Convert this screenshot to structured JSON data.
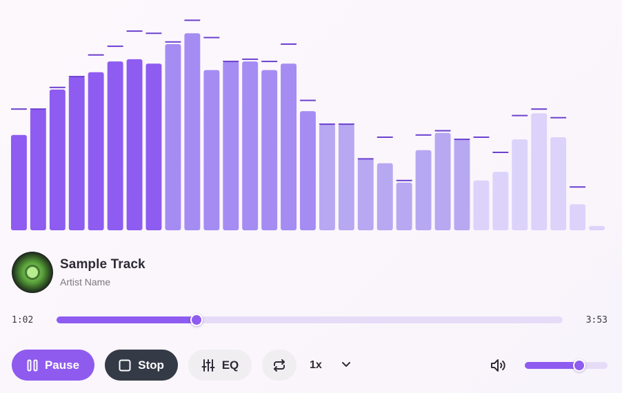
{
  "visualizer": {
    "levels": [
      0.44,
      0.56,
      0.65,
      0.71,
      0.73,
      0.78,
      0.79,
      0.77,
      0.86,
      0.91,
      0.74,
      0.78,
      0.78,
      0.74,
      0.77,
      0.55,
      0.49,
      0.49,
      0.33,
      0.31,
      0.22,
      0.37,
      0.45,
      0.42,
      0.23,
      0.27,
      0.42,
      0.54,
      0.43,
      0.12,
      0.02
    ],
    "peaks": [
      0.56,
      0.56,
      0.66,
      0.71,
      0.81,
      0.85,
      0.92,
      0.91,
      0.87,
      0.97,
      0.89,
      0.78,
      0.79,
      0.78,
      0.86,
      0.6,
      0.49,
      0.49,
      0.33,
      0.43,
      0.23,
      0.44,
      0.46,
      0.42,
      0.43,
      0.36,
      0.53,
      0.56,
      0.52,
      0.2,
      null
    ],
    "colors": {
      "bar_strong": "#8e5cf0",
      "bar_mid": "#a58cf3",
      "bar_soft": "#b7a8f2",
      "bar_faint": "#dcd3fb",
      "peak": "#6b3fcf"
    }
  },
  "track": {
    "title": "Sample Track",
    "artist": "Artist Name",
    "cover_icon": "album-art"
  },
  "playback": {
    "current_time": "1:02",
    "duration": "3:53",
    "progress": 0.276
  },
  "controls": {
    "pause_label": "Pause",
    "stop_label": "Stop",
    "eq_label": "EQ",
    "speed_value": "1x",
    "volume": 0.66
  },
  "icons": {
    "pause": "pause-icon",
    "stop": "stop-icon",
    "eq": "sliders-icon",
    "loop": "repeat-icon",
    "speed": "chevron-down-icon",
    "volume": "volume-icon"
  }
}
